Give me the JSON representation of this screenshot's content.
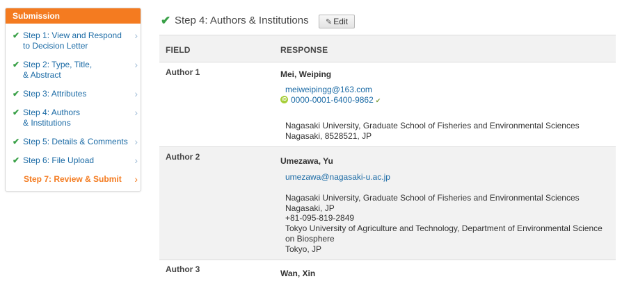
{
  "sidebar": {
    "title": "Submission",
    "steps": [
      {
        "label": "Step 1: View and Respond to Decision Letter"
      },
      {
        "label": "Step 2: Type, Title, & Abstract"
      },
      {
        "label": "Step 3: Attributes"
      },
      {
        "label": "Step 4: Authors & Institutions"
      },
      {
        "label": "Step 5: Details & Comments"
      },
      {
        "label": "Step 6: File Upload"
      },
      {
        "label": "Step 7: Review & Submit"
      }
    ]
  },
  "main": {
    "title": "Step 4: Authors & Institutions",
    "edit_label": "Edit"
  },
  "table": {
    "headers": {
      "field": "FIELD",
      "response": "RESPONSE"
    },
    "authors": [
      {
        "field": "Author 1",
        "name": "Mei, Weiping",
        "email": "meiweipingg@163.com",
        "orcid": "0000-0001-6400-9862",
        "institution_1": "Nagasaki University, Graduate School of Fisheries and Environmental Sciences",
        "address_1": "Nagasaki, 8528521, JP"
      },
      {
        "field": "Author 2",
        "name": "Umezawa, Yu",
        "email": "umezawa@nagasaki-u.ac.jp",
        "institution_1": "Nagasaki University, Graduate School of Fisheries and Environmental Sciences",
        "address_1": "Nagasaki, JP",
        "phone": "+81-095-819-2849",
        "institution_2": "Tokyo University of Agriculture and Technology, Department of Environmental Science",
        "institution_2_cont": "on Biosphere",
        "address_2": "Tokyo, JP"
      },
      {
        "field": "Author 3",
        "name": "Wan, Xin"
      }
    ]
  },
  "colors": {
    "accent": "#f47b20",
    "link": "#1a6aa5",
    "check": "#39a047",
    "orcid": "#a6ce39"
  },
  "icons": {
    "step_done": "check-icon",
    "step_arrow": "chevron-right-icon",
    "edit": "pencil-icon",
    "orcid": "orcid-icon"
  }
}
